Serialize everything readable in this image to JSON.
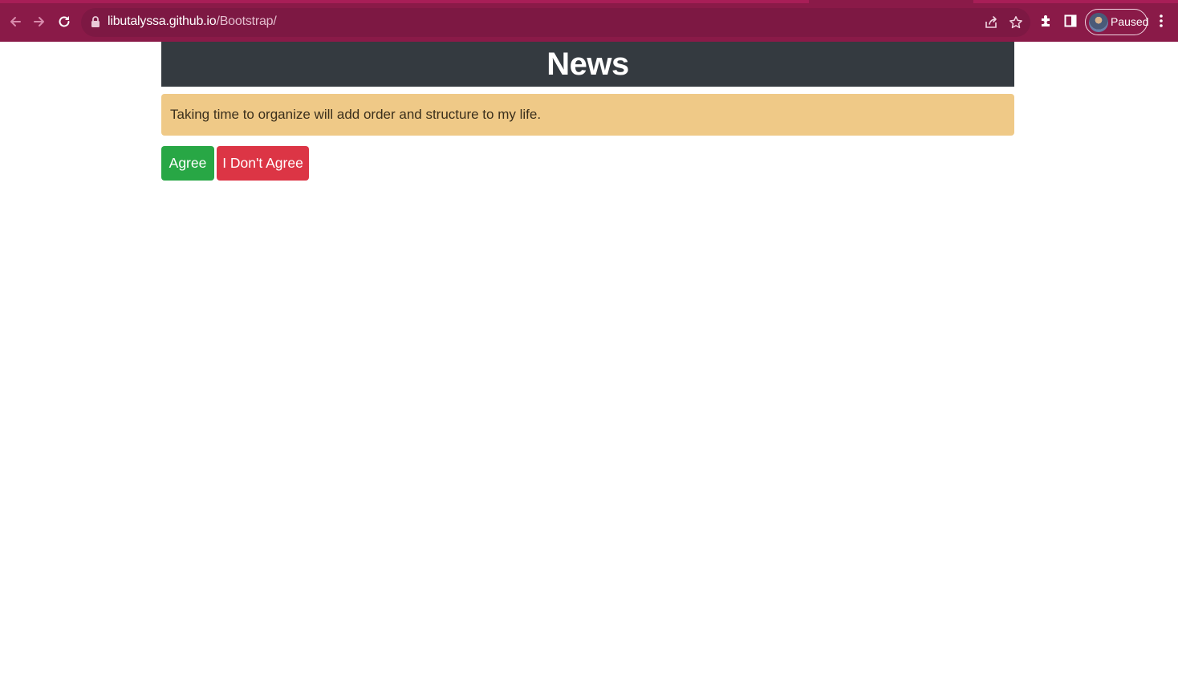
{
  "browser": {
    "url_host": "libutalyssa.github.io",
    "url_path": "/Bootstrap/",
    "profile_label": "Paused",
    "icons": [
      "back-icon",
      "forward-icon",
      "reload-icon",
      "lock-icon",
      "share-icon",
      "star-icon",
      "extensions-icon",
      "side-panel-icon",
      "avatar",
      "menu-icon"
    ],
    "theme_color": "#8a1a48"
  },
  "page": {
    "header_title": "News",
    "alert_text": "Taking time to organize will add order and structure to my life.",
    "agree_label": "Agree",
    "disagree_label": "I Don't Agree",
    "colors": {
      "header_bg": "#343a40",
      "alert_bg": "#efc987",
      "agree_bg": "#28a745",
      "disagree_bg": "#dc3545"
    }
  }
}
